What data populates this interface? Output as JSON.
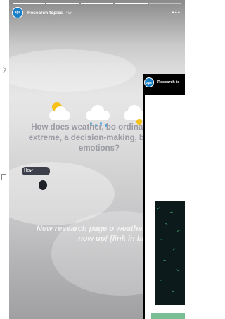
{
  "story": {
    "account_name": "Research topics",
    "age": "4w",
    "avatar_text": "aps",
    "more_label": "•••",
    "question": "How does weather, bo ordinary and extreme, a decision-making, behavio emotions?",
    "promo": "New research page o weather and behavio now up! [link in bio]"
  },
  "shared_story": {
    "account_name": "Research to",
    "avatar_text": "aps",
    "question_chip": "How",
    "image_tildes": [
      "~",
      "~",
      "~",
      "~",
      "~",
      "~",
      "~",
      "~",
      "~",
      "~"
    ]
  },
  "feed": {
    "ellipsis_top": "...",
    "ellipsis_bottom": "..."
  },
  "colors": {
    "brand_blue": "#1a7fc6",
    "question_text": "#9a9ba3",
    "accent_green": "#79bf94"
  }
}
